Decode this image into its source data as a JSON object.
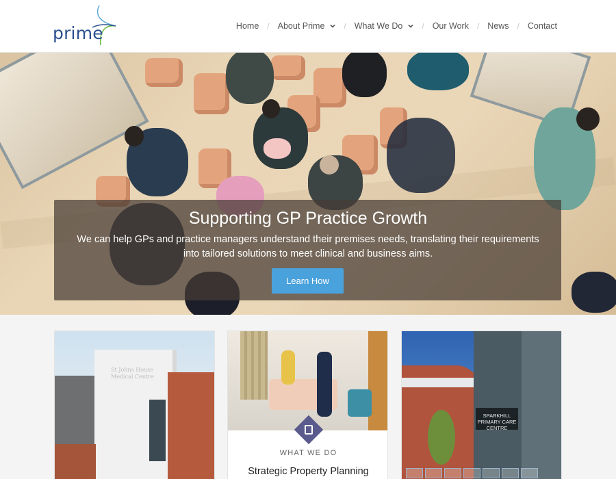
{
  "brand": {
    "logo_text": "prime"
  },
  "nav": {
    "items": [
      {
        "label": "Home",
        "dropdown": false
      },
      {
        "label": "About Prime",
        "dropdown": true
      },
      {
        "label": "What We Do",
        "dropdown": true
      },
      {
        "label": "Our Work",
        "dropdown": false
      },
      {
        "label": "News",
        "dropdown": false
      },
      {
        "label": "Contact",
        "dropdown": false
      }
    ],
    "separator": "/"
  },
  "hero": {
    "title": "Supporting GP Practice Growth",
    "subtitle": "We can help GPs and practice managers understand their premises needs, translating their requirements into tailored solutions to meet clinical and business aims.",
    "button_label": "Learn How"
  },
  "cards": [
    {
      "image_sign": "St Johns House Medical Centre"
    },
    {
      "category": "WHAT WE DO",
      "title": "Strategic Property Planning",
      "badge_icon": "tablet-icon"
    },
    {
      "image_sign": "SPARKHILL PRIMARY CARE CENTRE"
    }
  ],
  "colors": {
    "brand_blue": "#2a4f8f",
    "button_blue": "#4aa2dc",
    "badge_purple": "#5a5a8c"
  }
}
